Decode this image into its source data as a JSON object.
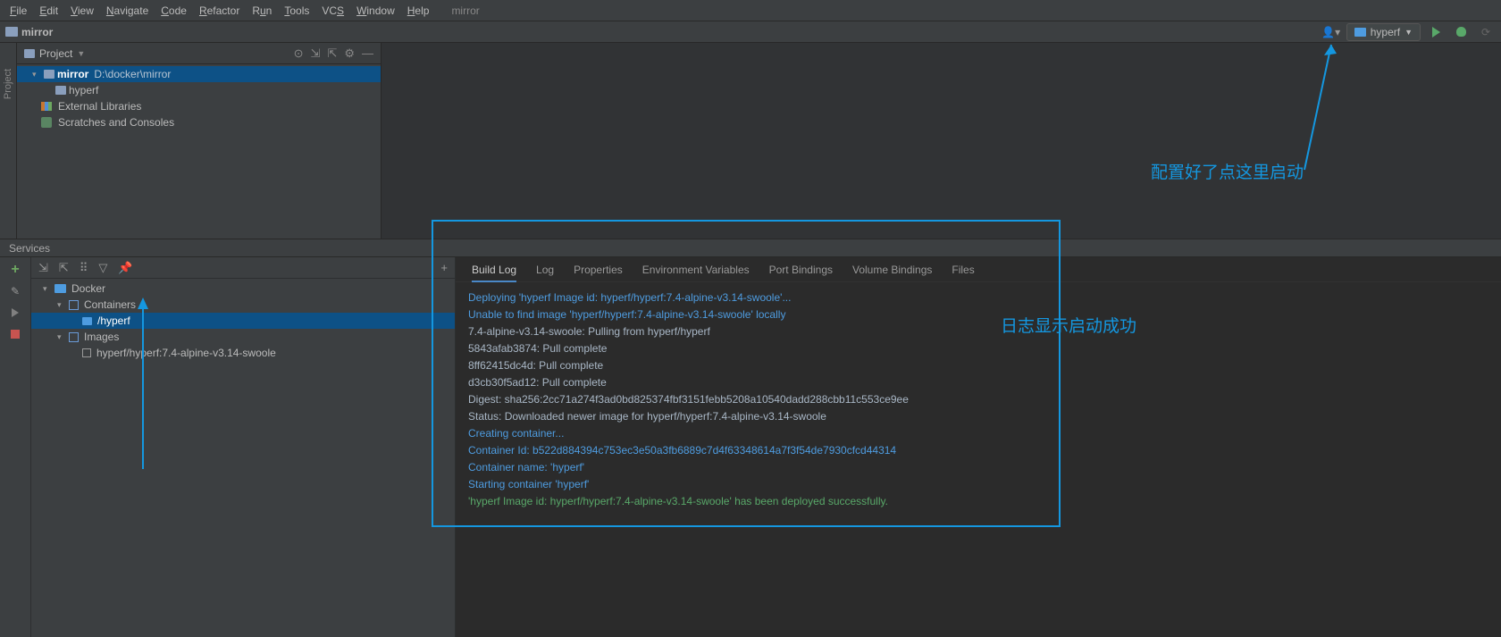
{
  "menubar": {
    "items": [
      "File",
      "Edit",
      "View",
      "Navigate",
      "Code",
      "Refactor",
      "Run",
      "Tools",
      "VCS",
      "Window",
      "Help"
    ],
    "project_context": "mirror"
  },
  "navbar": {
    "breadcrumb": "mirror",
    "run_config": "hyperf"
  },
  "sidebar": {
    "title": "Project",
    "tree": {
      "root": "mirror",
      "root_path": "D:\\docker\\mirror",
      "child1": "hyperf",
      "ext_libs": "External Libraries",
      "scratches": "Scratches and Consoles"
    }
  },
  "left_gutter_label": "Project",
  "services": {
    "title": "Services",
    "tree": {
      "docker": "Docker",
      "containers": "Containers",
      "container1": "/hyperf",
      "images": "Images",
      "image1": "hyperf/hyperf:7.4-alpine-v3.14-swoole"
    },
    "tabs": [
      "Build Log",
      "Log",
      "Properties",
      "Environment Variables",
      "Port Bindings",
      "Volume Bindings",
      "Files"
    ],
    "log": [
      {
        "cls": "log-blue",
        "text": "Deploying 'hyperf Image id: hyperf/hyperf:7.4-alpine-v3.14-swoole'..."
      },
      {
        "cls": "log-blue",
        "text": "Unable to find image 'hyperf/hyperf:7.4-alpine-v3.14-swoole' locally"
      },
      {
        "cls": "log-line",
        "text": "7.4-alpine-v3.14-swoole: Pulling from hyperf/hyperf"
      },
      {
        "cls": "log-line",
        "text": "5843afab3874: Pull complete"
      },
      {
        "cls": "log-line",
        "text": "8ff62415dc4d: Pull complete"
      },
      {
        "cls": "log-line",
        "text": "d3cb30f5ad12: Pull complete"
      },
      {
        "cls": "log-line",
        "text": "Digest: sha256:2cc71a274f3ad0bd825374fbf3151febb5208a10540dadd288cbb11c553ce9ee"
      },
      {
        "cls": "log-line",
        "text": "Status: Downloaded newer image for hyperf/hyperf:7.4-alpine-v3.14-swoole"
      },
      {
        "cls": "log-blue",
        "text": "Creating container..."
      },
      {
        "cls": "log-blue",
        "text": "Container Id: b522d884394c753ec3e50a3fb6889c7d4f63348614a7f3f54de7930cfcd44314"
      },
      {
        "cls": "log-blue",
        "text": "Container name: 'hyperf'"
      },
      {
        "cls": "log-blue",
        "text": "Starting container 'hyperf'"
      },
      {
        "cls": "log-green",
        "text": "'hyperf Image id: hyperf/hyperf:7.4-alpine-v3.14-swoole' has been deployed successfully."
      }
    ]
  },
  "annotations": {
    "a1": "配置好了点这里启动",
    "a2": "日志显示启动成功"
  }
}
